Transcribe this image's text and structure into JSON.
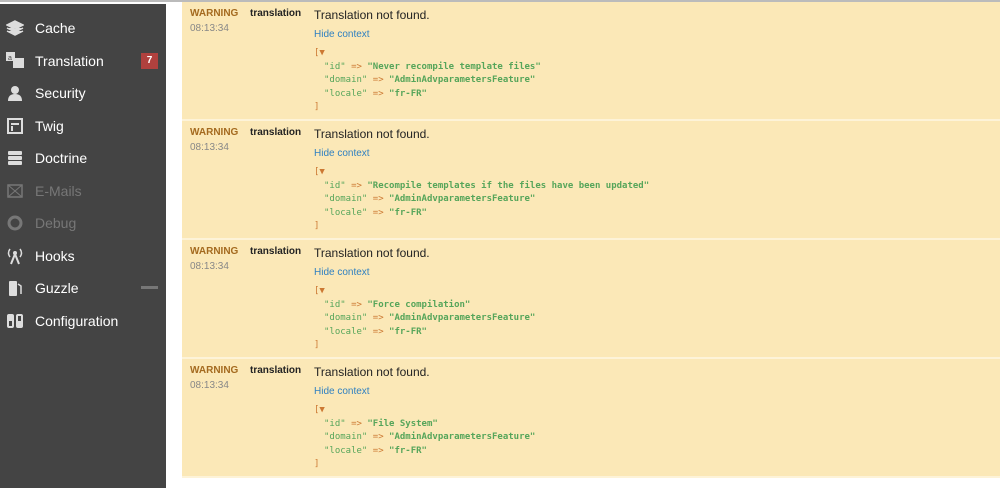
{
  "sidebar": {
    "items": [
      {
        "label": "Cache",
        "icon": "layers-icon"
      },
      {
        "label": "Translation",
        "icon": "translate-icon",
        "badge": "7"
      },
      {
        "label": "Security",
        "icon": "user-icon"
      },
      {
        "label": "Twig",
        "icon": "template-icon"
      },
      {
        "label": "Doctrine",
        "icon": "database-icon"
      },
      {
        "label": "E-Mails",
        "icon": "mail-icon",
        "disabled": true
      },
      {
        "label": "Debug",
        "icon": "crosshair-icon",
        "disabled": true
      },
      {
        "label": "Hooks",
        "icon": "antenna-icon"
      },
      {
        "label": "Guzzle",
        "icon": "fuel-icon"
      },
      {
        "label": "Configuration",
        "icon": "toggle-icon"
      }
    ]
  },
  "log": {
    "entries": [
      {
        "level": "WARNING",
        "time": "08:13:34",
        "channel": "translation",
        "message": "Translation not found.",
        "toggle": "Hide context",
        "id": "\"Never recompile template files\"",
        "domain": "\"AdminAdvparametersFeature\"",
        "locale": "\"fr-FR\""
      },
      {
        "level": "WARNING",
        "time": "08:13:34",
        "channel": "translation",
        "message": "Translation not found.",
        "toggle": "Hide context",
        "id": "\"Recompile templates if the files have been updated\"",
        "domain": "\"AdminAdvparametersFeature\"",
        "locale": "\"fr-FR\""
      },
      {
        "level": "WARNING",
        "time": "08:13:34",
        "channel": "translation",
        "message": "Translation not found.",
        "toggle": "Hide context",
        "id": "\"Force compilation\"",
        "domain": "\"AdminAdvparametersFeature\"",
        "locale": "\"fr-FR\""
      },
      {
        "level": "WARNING",
        "time": "08:13:34",
        "channel": "translation",
        "message": "Translation not found.",
        "toggle": "Hide context",
        "id": "\"File System\"",
        "domain": "\"AdminAdvparametersFeature\"",
        "locale": "\"fr-FR\""
      }
    ],
    "keys": {
      "id": "\"id\"",
      "domain": "\"domain\"",
      "locale": "\"locale\""
    },
    "arrow": "=>",
    "open": "[▼",
    "close": "]"
  }
}
